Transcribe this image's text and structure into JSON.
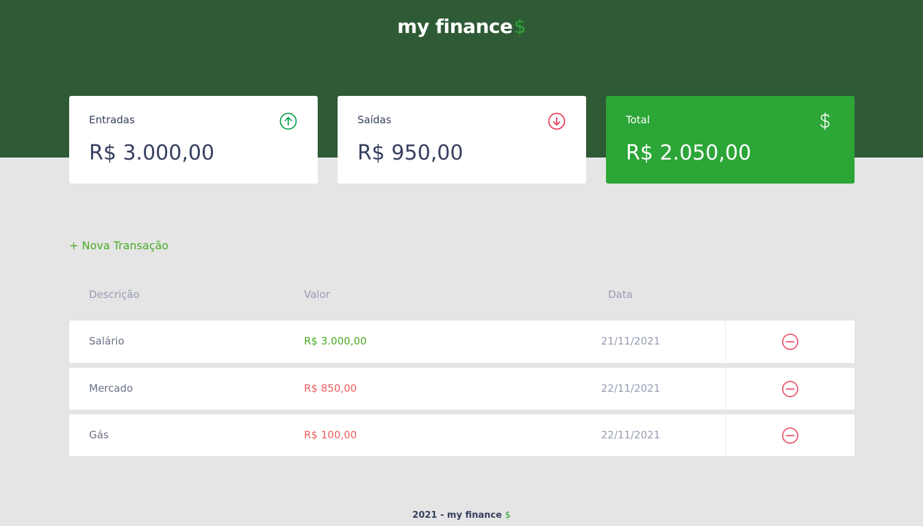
{
  "header": {
    "logo_text": "my finance",
    "logo_symbol": "$"
  },
  "cards": {
    "income": {
      "label": "Entradas",
      "value": "R$ 3.000,00",
      "icon": "arrow-up-circle-icon"
    },
    "expense": {
      "label": "Saídas",
      "value": "R$ 950,00",
      "icon": "arrow-down-circle-icon"
    },
    "total": {
      "label": "Total",
      "value": "R$ 2.050,00",
      "icon": "dollar-sign-icon"
    }
  },
  "new_transaction": "+ Nova Transação",
  "table": {
    "headers": {
      "description": "Descrição",
      "amount": "Valor",
      "date": "Data"
    },
    "rows": [
      {
        "description": "Salário",
        "amount": "R$ 3.000,00",
        "type": "income",
        "date": "21/11/2021"
      },
      {
        "description": "Mercado",
        "amount": "R$ 850,00",
        "type": "expense",
        "date": "22/11/2021"
      },
      {
        "description": "Gás",
        "amount": "R$ 100,00",
        "type": "expense",
        "date": "22/11/2021"
      }
    ]
  },
  "footer": {
    "text": "2021 - my finance",
    "symbol": "$"
  },
  "colors": {
    "header_bg": "#2f5a36",
    "page_bg": "#e5e5e5",
    "accent_green": "#2ca637",
    "income": "#49aa26",
    "expense": "#e92929",
    "text_dark": "#363f5f",
    "text_muted": "#969cb3"
  }
}
